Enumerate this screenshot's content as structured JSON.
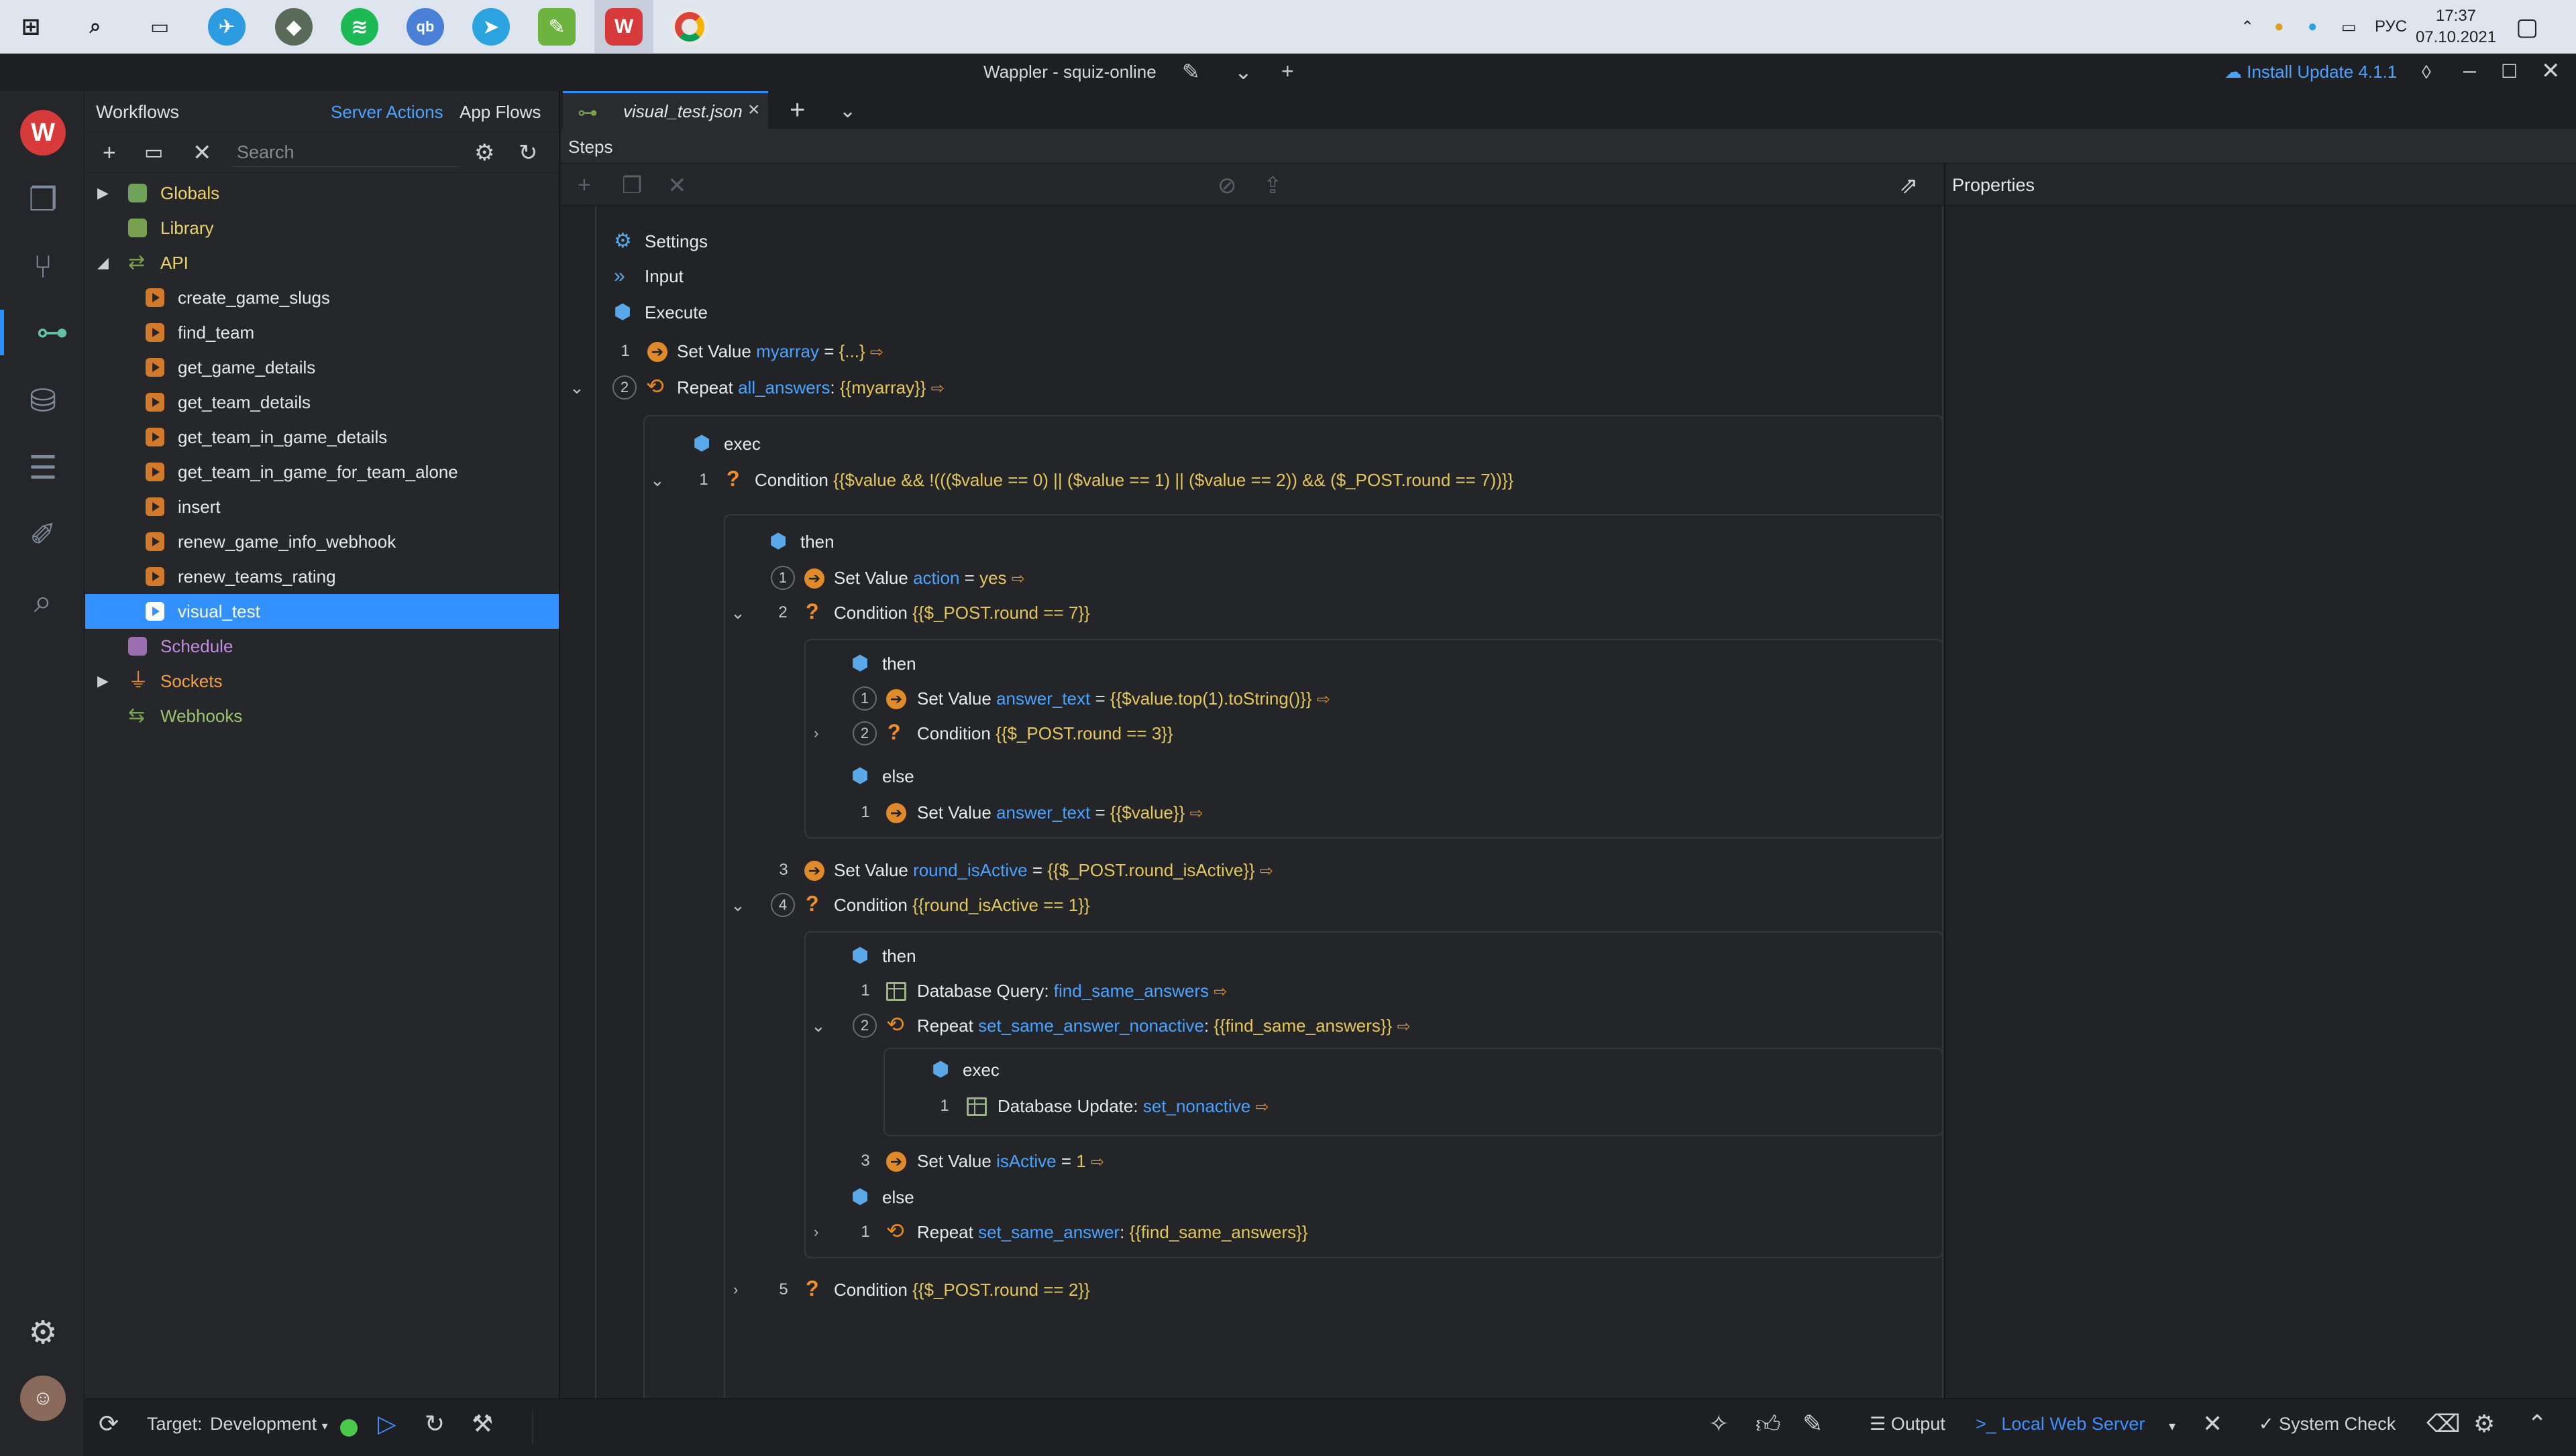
{
  "taskbar": {
    "lang": "РУС",
    "time": "17:37",
    "date": "07.10.2021"
  },
  "window": {
    "title": "Wappler - squiz-online",
    "install_update": "Install Update 4.1.1"
  },
  "explorer": {
    "title": "Workflows",
    "tab_server_actions": "Server Actions",
    "tab_app_flows": "App Flows",
    "search_placeholder": "Search",
    "tree": {
      "globals": "Globals",
      "library": "Library",
      "api": "API",
      "api_items": [
        "create_game_slugs",
        "find_team",
        "get_game_details",
        "get_team_details",
        "get_team_in_game_details",
        "get_team_in_game_for_team_alone",
        "insert",
        "renew_game_info_webhook",
        "renew_teams_rating",
        "visual_test"
      ],
      "schedule": "Schedule",
      "sockets": "Sockets",
      "webhooks": "Webhooks"
    }
  },
  "editor": {
    "tab_label": "visual_test.json",
    "steps_label": "Steps",
    "properties_label": "Properties",
    "sections": {
      "settings": "Settings",
      "input": "Input",
      "execute": "Execute"
    },
    "steps": {
      "s1": {
        "num": "1",
        "action": "Set Value",
        "name": "myarray",
        "op": " = ",
        "value": "{...}"
      },
      "s2": {
        "num": "2",
        "action": "Repeat",
        "name": "all_answers",
        "op": ": ",
        "value": "{{myarray}}"
      },
      "exec": "exec",
      "c1": {
        "num": "1",
        "action": "Condition",
        "value": "{{$value && !((($value == 0) || ($value == 1) || ($value == 2)) && ($_POST.round == 7))}}"
      },
      "then": "then",
      "else": "else",
      "t1": {
        "num": "1",
        "action": "Set Value",
        "name": "action",
        "op": " = ",
        "value": "yes"
      },
      "t2": {
        "num": "2",
        "action": "Condition",
        "value": "{{$_POST.round == 7}}"
      },
      "tt1": {
        "num": "1",
        "action": "Set Value",
        "name": "answer_text",
        "op": " = ",
        "value": "{{$value.top(1).toString()}}"
      },
      "tt2": {
        "num": "2",
        "action": "Condition",
        "value": "{{$_POST.round == 3}}"
      },
      "te1": {
        "num": "1",
        "action": "Set Value",
        "name": "answer_text",
        "op": " = ",
        "value": "{{$value}}"
      },
      "t3": {
        "num": "3",
        "action": "Set Value",
        "name": "round_isActive",
        "op": " = ",
        "value": "{{$_POST.round_isActive}}"
      },
      "t4": {
        "num": "4",
        "action": "Condition",
        "value": "{{round_isActive == 1}}"
      },
      "q1": {
        "num": "1",
        "action": "Database Query:",
        "name": "find_same_answers"
      },
      "q2": {
        "num": "2",
        "action": "Repeat",
        "name": "set_same_answer_nonactive",
        "op": ": ",
        "value": "{{find_same_answers}}"
      },
      "qe1": {
        "num": "1",
        "action": "Database Update:",
        "name": "set_nonactive"
      },
      "q3": {
        "num": "3",
        "action": "Set Value",
        "name": "isActive",
        "op": " = ",
        "value": "1"
      },
      "qel1": {
        "num": "1",
        "action": "Repeat",
        "name": "set_same_answer",
        "op": ": ",
        "value": "{{find_same_answers}}"
      },
      "t5": {
        "num": "5",
        "action": "Condition",
        "value": "{{$_POST.round == 2}}"
      }
    }
  },
  "statusbar": {
    "target_label": "Target:",
    "target_value": "Development",
    "output": "Output",
    "local_web_server": "Local Web Server",
    "system_check": "System Check"
  },
  "colors": {
    "accent": "#3390ff",
    "variable": "#4aa3ff",
    "expression": "#e3c75b",
    "action_icon": "#e08a2a",
    "server_running": "#4cc94c"
  }
}
